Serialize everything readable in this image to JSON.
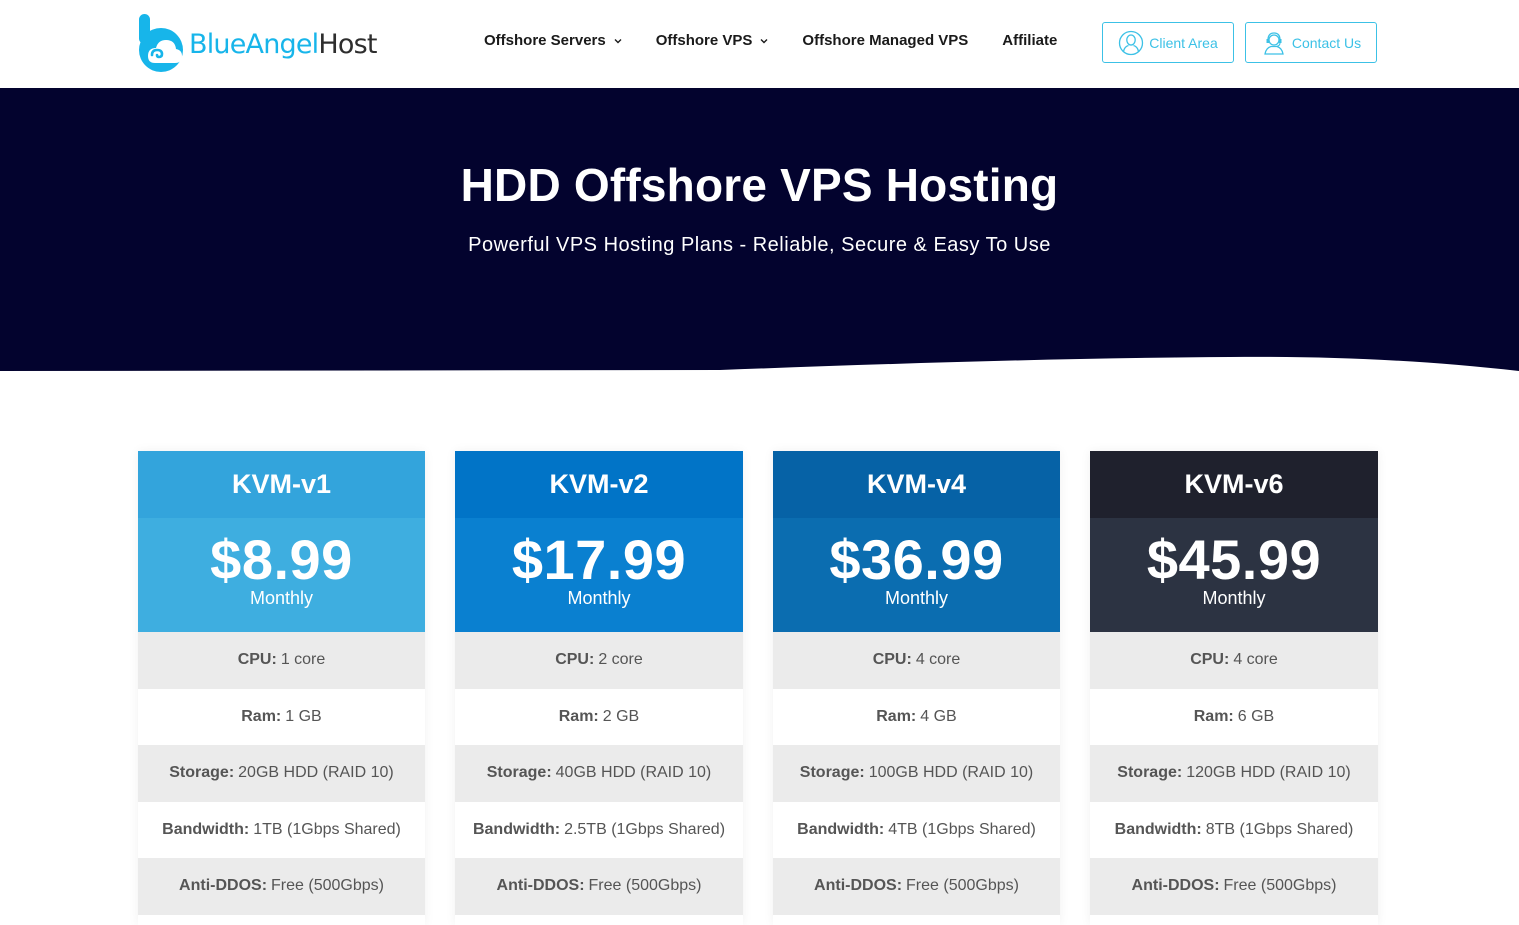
{
  "brand": {
    "part1": "BlueAngel",
    "part2": "Host",
    "colors": {
      "blue": "#17b5ea",
      "dark": "#2e2e2e"
    }
  },
  "nav": [
    {
      "label": "Offshore Servers",
      "has_dropdown": true
    },
    {
      "label": "Offshore VPS",
      "has_dropdown": true
    },
    {
      "label": "Offshore Managed VPS",
      "has_dropdown": false
    },
    {
      "label": "Affiliate",
      "has_dropdown": false
    }
  ],
  "header_buttons": {
    "client_area": {
      "label": "Client Area",
      "icon": "user-circle-icon"
    },
    "contact_us": {
      "label": "Contact Us",
      "icon": "headset-agent-icon"
    },
    "accent": "#3cc1e6"
  },
  "hero": {
    "title": "HDD Offshore VPS Hosting",
    "subtitle": "Powerful VPS Hosting Plans - Reliable, Secure & Easy To Use",
    "background": "#03032e"
  },
  "plans": [
    {
      "name": "KVM-v1",
      "price": "$8.99",
      "period": "Monthly",
      "head_color": "#33a4dc",
      "price_color": "#3eaee0",
      "features": [
        {
          "label": "CPU:",
          "value": "1 core"
        },
        {
          "label": "Ram:",
          "value": "1 GB"
        },
        {
          "label": "Storage:",
          "value": "20GB HDD (RAID 10)"
        },
        {
          "label": "Bandwidth:",
          "value": "1TB (1Gbps Shared)"
        },
        {
          "label": "Anti-DDOS:",
          "value": "Free (500Gbps)"
        }
      ]
    },
    {
      "name": "KVM-v2",
      "price": "$17.99",
      "period": "Monthly",
      "head_color": "#0174c7",
      "price_color": "#0a80d0",
      "features": [
        {
          "label": "CPU:",
          "value": "2 core"
        },
        {
          "label": "Ram:",
          "value": "2 GB"
        },
        {
          "label": "Storage:",
          "value": "40GB HDD (RAID 10)"
        },
        {
          "label": "Bandwidth:",
          "value": "2.5TB (1Gbps Shared)"
        },
        {
          "label": "Anti-DDOS:",
          "value": "Free (500Gbps)"
        }
      ]
    },
    {
      "name": "KVM-v4",
      "price": "$36.99",
      "period": "Monthly",
      "head_color": "#0662a6",
      "price_color": "#0b6db0",
      "features": [
        {
          "label": "CPU:",
          "value": "4 core"
        },
        {
          "label": "Ram:",
          "value": "4 GB"
        },
        {
          "label": "Storage:",
          "value": "100GB HDD (RAID 10)"
        },
        {
          "label": "Bandwidth:",
          "value": "4TB (1Gbps Shared)"
        },
        {
          "label": "Anti-DDOS:",
          "value": "Free (500Gbps)"
        }
      ]
    },
    {
      "name": "KVM-v6",
      "price": "$45.99",
      "period": "Monthly",
      "head_color": "#1f212d",
      "price_color": "#2c3342",
      "features": [
        {
          "label": "CPU:",
          "value": "4 core"
        },
        {
          "label": "Ram:",
          "value": "6 GB"
        },
        {
          "label": "Storage:",
          "value": "120GB HDD (RAID 10)"
        },
        {
          "label": "Bandwidth:",
          "value": "8TB (1Gbps Shared)"
        },
        {
          "label": "Anti-DDOS:",
          "value": "Free (500Gbps)"
        }
      ]
    }
  ]
}
